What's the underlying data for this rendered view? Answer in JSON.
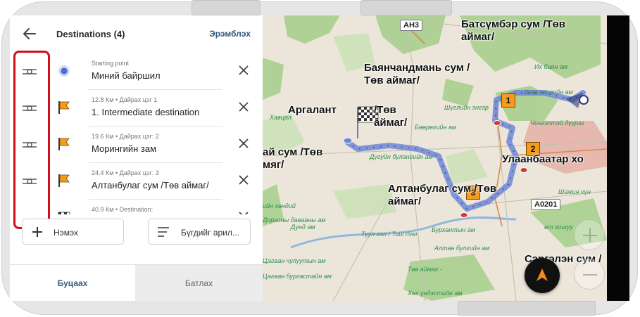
{
  "header": {
    "title": "Destinations (4)",
    "sort_label": "Эрэмблэх"
  },
  "destinations": [
    {
      "sub": "Starting point",
      "name": "Миний байршил",
      "icon": "current-location-icon"
    },
    {
      "sub": "12.8 Км  •  Дайрах цэг 1",
      "name": "1. Intermediate destination",
      "icon": "orange-flag-icon"
    },
    {
      "sub": "19.6 Км  •  Дайрах цэг: 2",
      "name": "Морингийн зам",
      "icon": "orange-flag-icon"
    },
    {
      "sub": "24.4 Км  •  Дайрах цэг: 3",
      "name": "Алтанбулаг сум /Төв аймаг/",
      "icon": "orange-flag-icon"
    },
    {
      "sub": "40.9 Км  •  Destination:",
      "name": "",
      "icon": "checkered-flag-icon"
    }
  ],
  "actions": {
    "add_label": "Нэмэх",
    "clear_label": "Бүгдийг арил..."
  },
  "footer": {
    "cancel_label": "Буцаах",
    "confirm_label": "Батлах"
  },
  "map": {
    "labels": {
      "batsumber": "Батсүмбэр сум /Төв\nаймаг/",
      "bayanchandmani": "Баянчандмань сум /\nТөв аймаг/",
      "argalant": "Аргалант",
      "argalant_tail": "/Төв\nаймаг/",
      "lun": "сум /Төв\nаймаг/",
      "lun_prefix": "ай сум /Төв",
      "ulaanbaatar": "Улаанбаатар хо",
      "altanbulag": "Алтанбулаг сум /Төв\nаймаг/",
      "sergelen": "Сэргэлэн сум /\nаймаг/"
    },
    "small_labels": {
      "ikh_bayan": "Их баян ам",
      "shar_khooloi": "Шар хоолойн ам",
      "shuglyn": "Шүглийн энгэр",
      "boorog": "Бөөрөгийн ам",
      "khavtsal": "Хавцал",
      "dugui": "Дугуйн булангийн ам",
      "burkhant": "Бурхантын ам",
      "altan_bulgiin": "Алтан булгийн ам",
      "tuv_aimag": "Төв аймаг -",
      "khokh_undes": "Хөх үндэстийн ам",
      "tuul": "Туул гол / Tuul river",
      "dorgon": "Доргоны давааны ам",
      "shazhin": "Шажин хүн",
      "chuluut": "Цагаан чулуутын ам",
      "burgastai": "Цагаан бургастайн ам",
      "khondiyn": "ийн хөндий",
      "dund_am": "Дунд ам",
      "ud_khoshuu": "өт хошуу",
      "chingeltei": "Чингэлтэй дүүрэг"
    },
    "road_badges": [
      "АН3",
      "А0201"
    ],
    "pins": [
      "1",
      "2",
      "3"
    ]
  },
  "colors": {
    "route": "#6f86d6",
    "accent": "#36587a",
    "highlight": "#d0101c",
    "flag": "#f29b1d"
  }
}
